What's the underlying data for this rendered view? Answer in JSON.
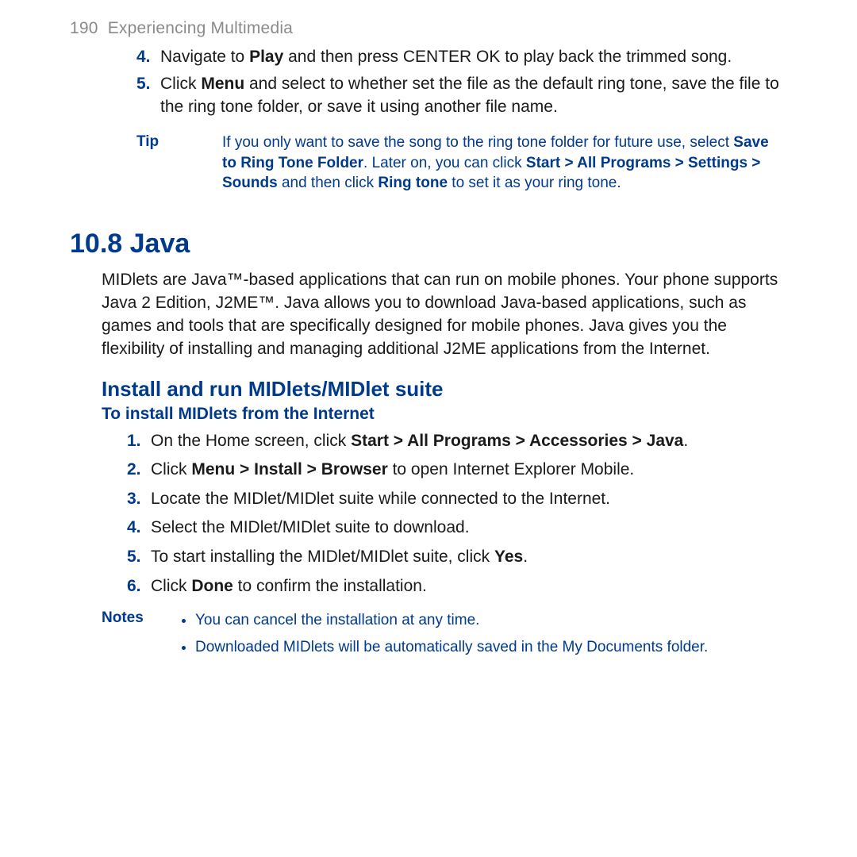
{
  "header": {
    "page_number": "190",
    "chapter_title": "Experiencing Multimedia"
  },
  "steps_top": [
    {
      "num": "4.",
      "parts": [
        {
          "t": "Navigate to ",
          "b": false
        },
        {
          "t": "Play",
          "b": true
        },
        {
          "t": " and then press CENTER OK to play back the trimmed song.",
          "b": false
        }
      ]
    },
    {
      "num": "5.",
      "parts": [
        {
          "t": "Click ",
          "b": false
        },
        {
          "t": "Menu",
          "b": true
        },
        {
          "t": " and select to whether set the file as the default ring tone, save the file to the ring tone folder, or save it using another file name.",
          "b": false
        }
      ]
    }
  ],
  "tip": {
    "label": "Tip",
    "parts": [
      {
        "t": "If you only want to save the song to the ring tone folder for future use, select ",
        "b": false
      },
      {
        "t": "Save to Ring Tone Folder",
        "b": true
      },
      {
        "t": ". Later on, you can click ",
        "b": false
      },
      {
        "t": "Start > All Programs > Settings > Sounds",
        "b": true
      },
      {
        "t": " and then click ",
        "b": false
      },
      {
        "t": "Ring tone",
        "b": true
      },
      {
        "t": " to set it as your ring tone.",
        "b": false
      }
    ]
  },
  "section_heading": "10.8  Java",
  "intro_para": "MIDlets are Java™-based applications that can run on mobile phones. Your phone supports Java 2 Edition, J2ME™. Java allows you to download Java-based applications, such as games and tools that are specifically designed for mobile phones. Java gives you the flexibility of installing and managing additional J2ME applications from the Internet.",
  "subheading": "Install and run MIDlets/MIDlet suite",
  "task_heading": "To install MIDlets from the Internet",
  "steps_b": [
    {
      "num": "1.",
      "parts": [
        {
          "t": "On the Home screen, click ",
          "b": false
        },
        {
          "t": "Start > All Programs > Accessories > Java",
          "b": true
        },
        {
          "t": ".",
          "b": false
        }
      ]
    },
    {
      "num": "2.",
      "parts": [
        {
          "t": "Click ",
          "b": false
        },
        {
          "t": "Menu > Install > Browser",
          "b": true
        },
        {
          "t": " to open Internet Explorer Mobile.",
          "b": false
        }
      ]
    },
    {
      "num": "3.",
      "parts": [
        {
          "t": "Locate the MIDlet/MIDlet suite while connected to the Internet.",
          "b": false
        }
      ]
    },
    {
      "num": "4.",
      "parts": [
        {
          "t": "Select the MIDlet/MIDlet suite to download.",
          "b": false
        }
      ]
    },
    {
      "num": "5.",
      "parts": [
        {
          "t": "To start installing the MIDlet/MIDlet suite, click ",
          "b": false
        },
        {
          "t": "Yes",
          "b": true
        },
        {
          "t": ".",
          "b": false
        }
      ]
    },
    {
      "num": "6.",
      "parts": [
        {
          "t": "Click ",
          "b": false
        },
        {
          "t": "Done",
          "b": true
        },
        {
          "t": " to confirm the installation.",
          "b": false
        }
      ]
    }
  ],
  "notes": {
    "label": "Notes",
    "items": [
      "You can cancel the installation at any time.",
      "Downloaded MIDlets will be automatically saved in the My Documents folder."
    ]
  }
}
